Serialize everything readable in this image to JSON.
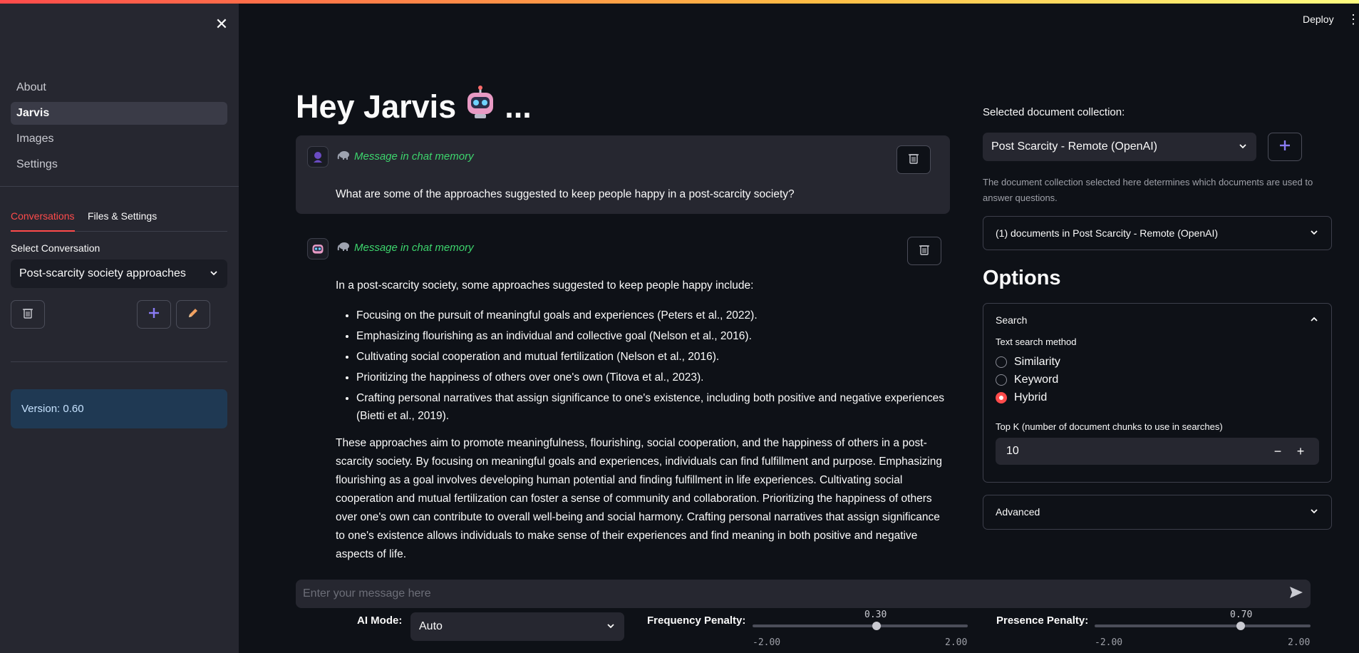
{
  "sidebar": {
    "nav": [
      {
        "label": "About"
      },
      {
        "label": "Jarvis"
      },
      {
        "label": "Images"
      },
      {
        "label": "Settings"
      }
    ],
    "tabs": [
      {
        "label": "Conversations"
      },
      {
        "label": "Files & Settings"
      }
    ],
    "select_label": "Select Conversation",
    "select_value": "Post-scarcity society approaches",
    "version": "Version: 0.60"
  },
  "header": {
    "deploy_label": "Deploy"
  },
  "main": {
    "title": "Hey Jarvis",
    "title_suffix": "...",
    "memory_label": "Message in chat memory",
    "user_message": "What are some of the approaches suggested to keep people happy in a post-scarcity society?",
    "assistant_intro": "In a post-scarcity society, some approaches suggested to keep people happy include:",
    "assistant_bullets": [
      "Focusing on the pursuit of meaningful goals and experiences (Peters et al., 2022).",
      "Emphasizing flourishing as an individual and collective goal (Nelson et al., 2016).",
      "Cultivating social cooperation and mutual fertilization (Nelson et al., 2016).",
      "Prioritizing the happiness of others over one's own (Titova et al., 2023).",
      "Crafting personal narratives that assign significance to one's existence, including both positive and negative experiences (Bietti et al., 2019)."
    ],
    "assistant_summary": "These approaches aim to promote meaningfulness, flourishing, social cooperation, and the happiness of others in a post-scarcity society. By focusing on meaningful goals and experiences, individuals can find fulfillment and purpose. Emphasizing flourishing as a goal involves developing human potential and finding fulfillment in life experiences. Cultivating social cooperation and mutual fertilization can foster a sense of community and collaboration. Prioritizing the happiness of others over one's own can contribute to overall well-being and social harmony. Crafting personal narratives that assign significance to one's existence allows individuals to make sense of their experiences and find meaning in both positive and negative aspects of life.",
    "chat_placeholder": "Enter your message here"
  },
  "right_panel": {
    "collection_label": "Selected document collection:",
    "collection_value": "Post Scarcity - Remote (OpenAI)",
    "collection_help": "The document collection selected here determines which documents are used to answer questions.",
    "documents_expander": "(1) documents in Post Scarcity - Remote (OpenAI)",
    "options_heading": "Options",
    "search_expander": "Search",
    "search_method_label": "Text search method",
    "search_methods": [
      {
        "label": "Similarity",
        "selected": false
      },
      {
        "label": "Keyword",
        "selected": false
      },
      {
        "label": "Hybrid",
        "selected": true
      }
    ],
    "top_k_label": "Top K (number of document chunks to use in searches)",
    "top_k_value": "10",
    "advanced_expander": "Advanced"
  },
  "bottom": {
    "ai_mode_label": "AI Mode:",
    "ai_mode_value": "Auto",
    "frequency_label": "Frequency Penalty:",
    "frequency_value": "0.30",
    "frequency_min": "-2.00",
    "frequency_max": "2.00",
    "presence_label": "Presence Penalty:",
    "presence_value": "0.70",
    "presence_min": "-2.00",
    "presence_max": "2.00"
  },
  "colors": {
    "accent": "#ff4b4b",
    "memory_text": "#3dd56d",
    "version_bg": "#1f3953"
  },
  "icons": [
    "close-icon",
    "trash-icon",
    "plus-icon",
    "pencil-icon",
    "robot-icon",
    "user-avatar-icon",
    "elephant-icon",
    "chevron-down-icon",
    "chevron-up-icon",
    "send-icon",
    "kebab-icon",
    "minus-icon"
  ]
}
